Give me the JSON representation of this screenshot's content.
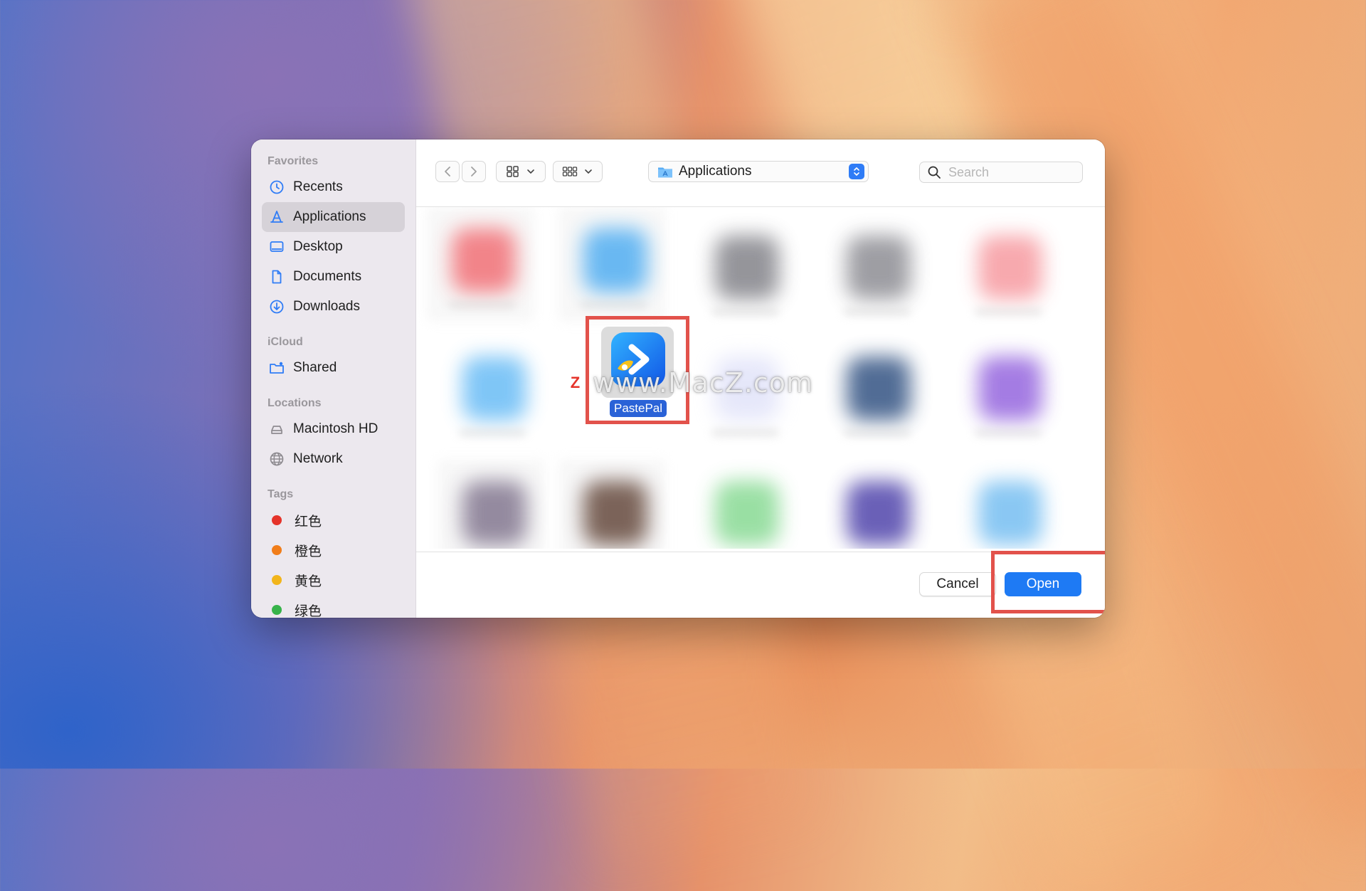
{
  "sidebar": {
    "favorites_title": "Favorites",
    "favorites": [
      {
        "label": "Recents",
        "icon": "clock-icon",
        "selected": false
      },
      {
        "label": "Applications",
        "icon": "applications-icon",
        "selected": true
      },
      {
        "label": "Desktop",
        "icon": "desktop-icon",
        "selected": false
      },
      {
        "label": "Documents",
        "icon": "document-icon",
        "selected": false
      },
      {
        "label": "Downloads",
        "icon": "download-icon",
        "selected": false
      }
    ],
    "icloud_title": "iCloud",
    "icloud": [
      {
        "label": "Shared",
        "icon": "shared-folder-icon"
      }
    ],
    "locations_title": "Locations",
    "locations": [
      {
        "label": "Macintosh HD",
        "icon": "disk-icon"
      },
      {
        "label": "Network",
        "icon": "globe-icon"
      }
    ],
    "tags_title": "Tags",
    "tags": [
      {
        "label": "红色",
        "color": "#e5332a"
      },
      {
        "label": "橙色",
        "color": "#f17d1a"
      },
      {
        "label": "黄色",
        "color": "#f2b51b"
      },
      {
        "label": "绿色",
        "color": "#37b34a"
      }
    ]
  },
  "toolbar": {
    "location": "Applications",
    "search_placeholder": "Search"
  },
  "files": {
    "selected_item_label": "PastePal"
  },
  "watermark": {
    "logo_letter": "Z",
    "text": "www.MacZ.com"
  },
  "footer": {
    "cancel_label": "Cancel",
    "open_label": "Open"
  },
  "colors": {
    "accent": "#1e7af4",
    "highlight": "#e2524b",
    "selection": "#2a62d7"
  }
}
